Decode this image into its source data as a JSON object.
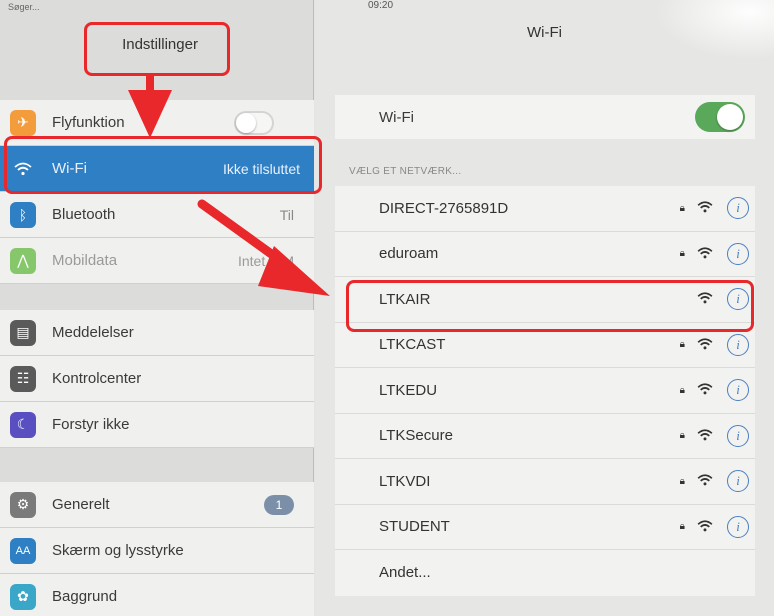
{
  "status": {
    "carrier": "Søger...",
    "time": "09:20"
  },
  "left_pane": {
    "title": "Indstillinger",
    "groups": [
      {
        "items": [
          {
            "label": "Flyfunktion",
            "icon": "airplane-icon",
            "color": "#f39c3c",
            "control": "toggle-off"
          },
          {
            "label": "Wi-Fi",
            "icon": "wifi-icon",
            "color": "#2e7fc4",
            "value": "Ikke tilsluttet",
            "selected": true
          },
          {
            "label": "Bluetooth",
            "icon": "bluetooth-icon",
            "color": "#2e7fc4",
            "value": "Til"
          },
          {
            "label": "Mobildata",
            "icon": "antenna-icon",
            "color": "#86c76c",
            "value": "Intet SIM",
            "dim": true
          }
        ]
      },
      {
        "items": [
          {
            "label": "Meddelelser",
            "icon": "notifications-icon",
            "color": "#5a5a5a"
          },
          {
            "label": "Kontrolcenter",
            "icon": "control-center-icon",
            "color": "#5a5a5a"
          },
          {
            "label": "Forstyr ikke",
            "icon": "moon-icon",
            "color": "#5a4fc0"
          }
        ]
      },
      {
        "items": [
          {
            "label": "Generelt",
            "icon": "gear-icon",
            "color": "#7a7a7a",
            "badge": "1"
          },
          {
            "label": "Skærm og lysstyrke",
            "icon": "display-icon",
            "color": "#2e7fc4"
          },
          {
            "label": "Baggrund",
            "icon": "wallpaper-icon",
            "color": "#3aa6c8"
          }
        ]
      }
    ]
  },
  "right_pane": {
    "title": "Wi-Fi",
    "wifi_toggle_label": "Wi-Fi",
    "wifi_on": true,
    "section_header": "VÆLG ET NETVÆRK...",
    "networks": [
      {
        "name": "DIRECT-2765891D",
        "locked": true
      },
      {
        "name": "eduroam",
        "locked": true
      },
      {
        "name": "LTKAIR",
        "locked": false,
        "highlighted": true
      },
      {
        "name": "LTKCAST",
        "locked": true
      },
      {
        "name": "LTKEDU",
        "locked": true
      },
      {
        "name": "LTKSecure",
        "locked": true
      },
      {
        "name": "LTKVDI",
        "locked": true
      },
      {
        "name": "STUDENT",
        "locked": true
      }
    ],
    "other_label": "Andet..."
  },
  "colors": {
    "highlight": "#e8282b",
    "accent": "#2e7fc4",
    "toggle_on": "#5aa85a"
  }
}
